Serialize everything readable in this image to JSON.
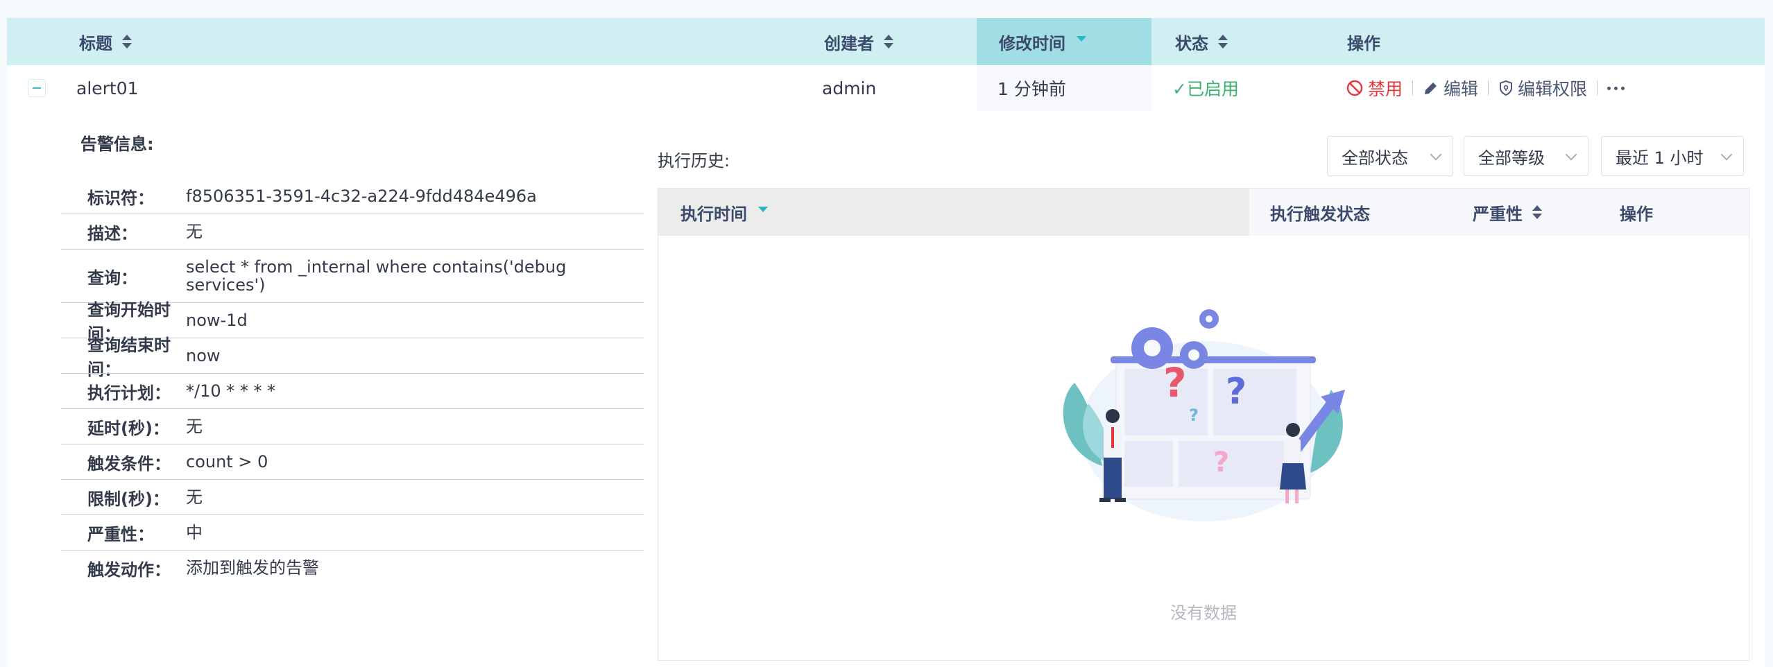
{
  "table": {
    "headers": {
      "title": "标题",
      "creator": "创建者",
      "modified": "修改时间",
      "status": "状态",
      "actions": "操作"
    },
    "row": {
      "title": "alert01",
      "creator": "admin",
      "modified": "1 分钟前",
      "status": "✓已启用",
      "actions": {
        "disable": "禁用",
        "edit": "编辑",
        "edit_permissions": "编辑权限"
      }
    }
  },
  "detail": {
    "section_title": "告警信息:",
    "fields": [
      {
        "key": "标识符：",
        "value": "f8506351-3591-4c32-a224-9fdd484e496a"
      },
      {
        "key": "描述：",
        "value": "无"
      },
      {
        "key": "查询：",
        "value": "select * from _internal where contains('debug services')"
      },
      {
        "key": "查询开始时间：",
        "value": "now-1d"
      },
      {
        "key": "查询结束时间：",
        "value": "now"
      },
      {
        "key": "执行计划：",
        "value": "*/10 * * * *"
      },
      {
        "key": "延时(秒)：",
        "value": "无"
      },
      {
        "key": "触发条件：",
        "value": "count > 0"
      },
      {
        "key": "限制(秒)：",
        "value": "无"
      },
      {
        "key": "严重性：",
        "value": "中"
      },
      {
        "key": "触发动作：",
        "value": "添加到触发的告警"
      }
    ]
  },
  "history": {
    "title": "执行历史:",
    "filters": {
      "status": "全部状态",
      "level": "全部等级",
      "time_range": "最近 1 小时"
    },
    "headers": {
      "exec_time": "执行时间",
      "trigger_status": "执行触发状态",
      "severity": "严重性",
      "actions": "操作"
    },
    "empty_text": "没有数据"
  },
  "colors": {
    "header_bg": "#cfeff2",
    "sorted_header_bg": "#a1dee4",
    "enabled": "#3cb371",
    "danger": "#e5363c",
    "accent": "#2cb5c5"
  }
}
